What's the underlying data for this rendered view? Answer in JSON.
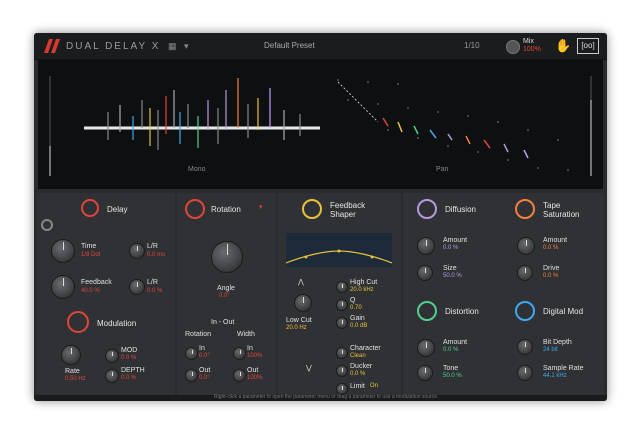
{
  "header": {
    "title": "DUAL DELAY X",
    "preset_name": "Default Preset",
    "preset_number": "1/10",
    "mix_label": "Mix",
    "mix_value": "100%",
    "brand_box": "[oo]"
  },
  "display": {
    "left_label": "Mono",
    "right_label": "Pan"
  },
  "delay": {
    "title": "Delay",
    "time_label": "Time",
    "time_value": "1/8 Dot",
    "lr_label": "L/R",
    "lr_value": "0.0 ms",
    "feedback_label": "Feedback",
    "feedback_value": "40.0 %",
    "lr2_label": "L/R",
    "lr2_value": "0.0 %"
  },
  "modulation": {
    "title": "Modulation",
    "rate_label": "Rate",
    "rate_value": "0.50 Hz",
    "mod_label": "MOD",
    "mod_value": "0.0 %",
    "depth_label": "DEPTH",
    "depth_value": "0.0 %"
  },
  "rotation": {
    "title": "Rotation",
    "angle_label": "Angle",
    "angle_value": "0.0°",
    "inout_label": "In - Out",
    "rot_label": "Rotation",
    "width_label": "Width",
    "in1": "In",
    "in1_value": "0.0°",
    "in2": "In",
    "in2_value": "100%",
    "out1": "Out",
    "out1_value": "0.0°",
    "out2": "Out",
    "out2_value": "100%"
  },
  "feedback_shaper": {
    "title_line1": "Feedback",
    "title_line2": "Shaper",
    "low_label": "Low Cut",
    "low_value": "20.0 Hz",
    "high_label": "High Cut",
    "high_value": "20.0 kHz",
    "q_label": "Q",
    "q_value": "0.70",
    "gain_label": "Gain",
    "gain_value": "0.0 dB",
    "character_label": "Character",
    "character_value": "Clean",
    "ducker_label": "Ducker",
    "ducker_value": "0.0 %",
    "limit_label": "Limit",
    "limit_value": "On"
  },
  "diffusion": {
    "title": "Diffusion",
    "amount_label": "Amount",
    "amount_value": "0.0 %",
    "size_label": "Size",
    "size_value": "50.0 %"
  },
  "tape": {
    "title_line1": "Tape",
    "title_line2": "Saturation",
    "amount_label": "Amount",
    "amount_value": "0.0 %",
    "drive_label": "Drive",
    "drive_value": "0.0 %"
  },
  "distortion": {
    "title": "Distortion",
    "amount_label": "Amount",
    "amount_value": "0.0 %",
    "tone_label": "Tone",
    "tone_value": "50.0 %"
  },
  "digital": {
    "title": "Digital Mod",
    "bitdepth_label": "Bit Depth",
    "bitdepth_value": "24 bit",
    "samplerate_label": "Sample Rate",
    "samplerate_value": "44.1 kHz"
  },
  "status": {
    "text": "Right-click a parameter to open the parameter menu or drag a parameter to use a modulation source."
  },
  "colors": {
    "delay": "#e0453a",
    "rotation": "#e0453a",
    "feedback": "#e8c23a",
    "diffusion": "#b39ae0",
    "tape": "#f08040",
    "distortion": "#50d090",
    "digital": "#40a8f0"
  }
}
